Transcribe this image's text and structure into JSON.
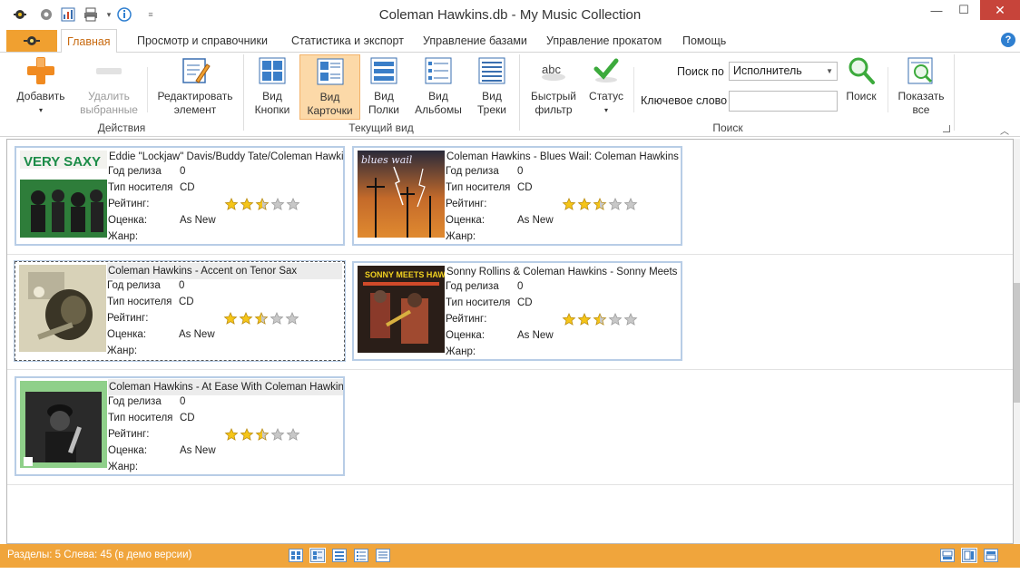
{
  "window": {
    "title": "Coleman Hawkins.db - My Music Collection"
  },
  "quick_access": [
    "app-icon",
    "settings-icon",
    "chart-icon",
    "print-icon",
    "info-icon",
    "customize-icon"
  ],
  "tabs": [
    "Главная",
    "Просмотр и справочники",
    "Статистика и экспорт",
    "Управление базами",
    "Управление прокатом",
    "Помощь"
  ],
  "ribbon": {
    "add": "Добавить",
    "delete_line1": "Удалить",
    "delete_line2": "выбранные",
    "edit_line1": "Редактировать",
    "edit_line2": "элемент",
    "group_actions": "Действия",
    "view_buttons_l1": "Вид",
    "view_buttons_l2": "Кнопки",
    "view_cards_l1": "Вид",
    "view_cards_l2": "Карточки",
    "view_shelves_l1": "Вид",
    "view_shelves_l2": "Полки",
    "view_albums_l1": "Вид",
    "view_albums_l2": "Альбомы",
    "view_tracks_l1": "Вид",
    "view_tracks_l2": "Треки",
    "group_view": "Текущий вид",
    "quick_filter_l1": "Быстрый",
    "quick_filter_l2": "фильтр",
    "status": "Статус",
    "search_by_label": "Поиск по",
    "search_by_value": "Исполнитель",
    "keyword_label": "Ключевое слово",
    "search": "Поиск",
    "show_all_l1": "Показать",
    "show_all_l2": "все",
    "group_search": "Поиск"
  },
  "labels": {
    "year": "Год релиза",
    "media": "Тип носителя",
    "rating": "Рейтинг:",
    "grade": "Оценка:",
    "genre": "Жанр:"
  },
  "albums": [
    {
      "title": "Eddie \"Lockjaw\" Davis/Buddy Tate/Coleman Hawkins/Arnett Cobb - Very Saxy",
      "year": "0",
      "media": "CD",
      "rating": 2.5,
      "grade": "As New",
      "genre": "",
      "cover_text": "VERY SAXY"
    },
    {
      "title": "Coleman Hawkins - Blues Wail: Coleman Hawkins Plays the Blues",
      "year": "0",
      "media": "CD",
      "rating": 2.5,
      "grade": "As New",
      "genre": "",
      "cover_text": "blues wail"
    },
    {
      "title": "Coleman Hawkins - Accent on Tenor Sax",
      "year": "0",
      "media": "CD",
      "rating": 2.5,
      "grade": "As New",
      "genre": "",
      "cover_text": ""
    },
    {
      "title": "Sonny Rollins & Coleman Hawkins - Sonny Meets Hawk!",
      "year": "0",
      "media": "CD",
      "rating": 2.5,
      "grade": "As New",
      "genre": "",
      "cover_text": "SONNY MEETS HAWK!"
    },
    {
      "title": "Coleman Hawkins - At Ease With Coleman Hawkins",
      "year": "0",
      "media": "CD",
      "rating": 2.5,
      "grade": "As New",
      "genre": "",
      "cover_text": ""
    }
  ],
  "status": {
    "text": "Разделы: 5  Слева: 45 (в демо версии)"
  },
  "colors": {
    "accent": "#f0a53c",
    "selected": "#fcd9a8",
    "card_border": "#b8cde6"
  }
}
